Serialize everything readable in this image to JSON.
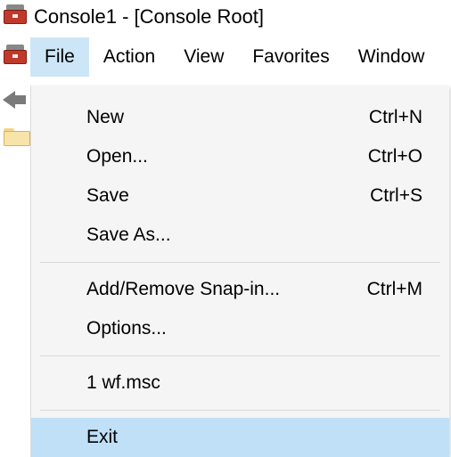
{
  "window": {
    "title": "Console1 - [Console Root]"
  },
  "menubar": {
    "items": [
      {
        "label": "File",
        "open": true
      },
      {
        "label": "Action",
        "open": false
      },
      {
        "label": "View",
        "open": false
      },
      {
        "label": "Favorites",
        "open": false
      },
      {
        "label": "Window",
        "open": false
      }
    ]
  },
  "file_menu": {
    "items": [
      {
        "label": "New",
        "shortcut": "Ctrl+N"
      },
      {
        "label": "Open...",
        "shortcut": "Ctrl+O"
      },
      {
        "label": "Save",
        "shortcut": "Ctrl+S"
      },
      {
        "label": "Save As...",
        "shortcut": ""
      }
    ],
    "items2": [
      {
        "label": "Add/Remove Snap-in...",
        "shortcut": "Ctrl+M"
      },
      {
        "label": "Options...",
        "shortcut": ""
      }
    ],
    "recent": [
      {
        "label": "1 wf.msc"
      }
    ],
    "exit": {
      "label": "Exit"
    }
  }
}
